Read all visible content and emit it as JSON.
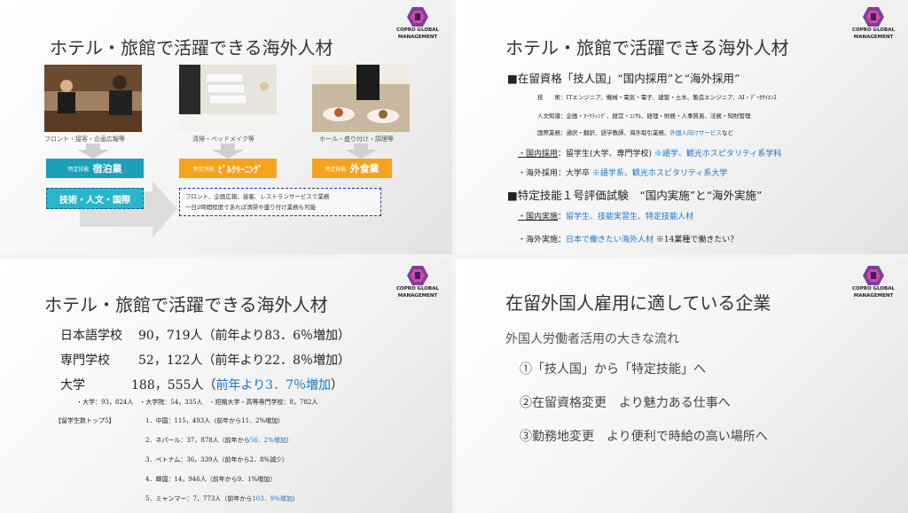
{
  "logo": {
    "line1": "COPRO GLOBAL",
    "line2": "MANAGEMENT"
  },
  "slide1": {
    "title": "ホテル・旅館で活躍できる海外人材",
    "cap_front": "フロント・接客・企画広報等",
    "cap_clean": "清掃・ベッドメイク等",
    "cap_hall": "ホール・盛り付け・調理等",
    "box_shukuhaku_small": "特定技能",
    "box_shukuhaku_big": "宿泊業",
    "box_building_small": "特定技能",
    "box_building_big": "ﾋﾞﾙｸﾘｰﾆﾝｸﾞ",
    "box_gaishoku_small": "特定技能",
    "box_gaishoku_big": "外食業",
    "box_gijinkoku": "技術・人文・国際",
    "note_line1": "フロント、企画広報、接客、レストランサービスで業務",
    "note_line2": "一日2時間程度であれば清掃や盛り付け業務も可能"
  },
  "slide2": {
    "title": "ホテル・旅館で活躍できる海外人材",
    "h1": "■在留資格「技人国」“国内採用”と“海外採用”",
    "gi_label": "技　　術：",
    "gi_text": "ITエンジニア、機械・電気・電子、建築・土木、製造エンジニア、AI・ﾃﾞｰﾀｻｲｴﾝｽ",
    "jin_label": "人文知識：",
    "jin_text": "企画・ﾏｰｹﾃｨﾝｸﾞ、経営・ｺﾝｻﾙ、経理・財務・人事質易、法務・知財管理",
    "koku_label": "国際業務：",
    "koku_text": "通訳・翻訳、語学教師、海外取引業務、",
    "koku_blue": "外国人向けサービス",
    "koku_tail": "など",
    "domestic_label": "・国内採用",
    "domestic_text": "：留学生(大学、専門学校)",
    "domestic_blue": "※語学、観光ホスピタリティ系学科",
    "overseas_label": "・海外採用",
    "overseas_text": "：大学卒",
    "overseas_blue": "※語学系、観光ホスピタリティ系大学",
    "h2": "■特定技能１号評価試験　“国内実施”と“海外実施”",
    "dom_impl_label": "・国内実施",
    "dom_impl_colon": "：",
    "dom_impl_blue": "留学生、技能実習生、特定技能人材",
    "ovs_impl_label": "・海外実施",
    "ovs_impl_colon": "：",
    "ovs_impl_blue": "日本で働きたい海外人材",
    "ovs_impl_tail": "※14業種で働きたい？"
  },
  "slide3": {
    "title": "ホテル・旅館で活躍できる海外人材",
    "row1_label": "日本語学校",
    "row1_value": "90，719人（前年より83．6％増加）",
    "row2_label": "専門学校",
    "row2_value": "52，122人（前年より22．8％増加）",
    "row3_label": "大学",
    "row3_value": "188，555人（",
    "row3_blue": "前年より3．7％増加",
    "row3_tail": "）",
    "sub_line": "・大学：93，824人　・大学院：54，335人　・短期大学・高等専門学校：8，782人",
    "top5_label": "【留学生数トップ5】",
    "r1": "1．中国：115，493人（前年から11．2%増加）",
    "r2_pre": "2．ネパール：37，878人（前年から",
    "r2_blue": "56．2%増加",
    "r2_post": "）",
    "r3": "3．ベトナム：36，339人（前年から2．8%減少）",
    "r4": "4．韓国：14，946人（前年から9．1%増加）",
    "r5_pre": "5．ミャンマー：7，773人（前年から",
    "r5_blue": "103．9%増加",
    "r5_post": "）"
  },
  "slide4": {
    "title": "在留外国人雇用に適している企業",
    "subtitle": "外国人労働者活用の大きな流れ",
    "item1": "①「技人国」から「特定技能」へ",
    "item2": "②在留資格変更　より魅力ある仕事へ",
    "item3": "③勤務地変更　より便利で時給の高い場所へ"
  },
  "colors": {
    "accent_blue": "#1a73c9",
    "teal_box": "#1aa0b8",
    "orange_box": "#f7a21c",
    "logo_purple": "#7b3fa0"
  }
}
